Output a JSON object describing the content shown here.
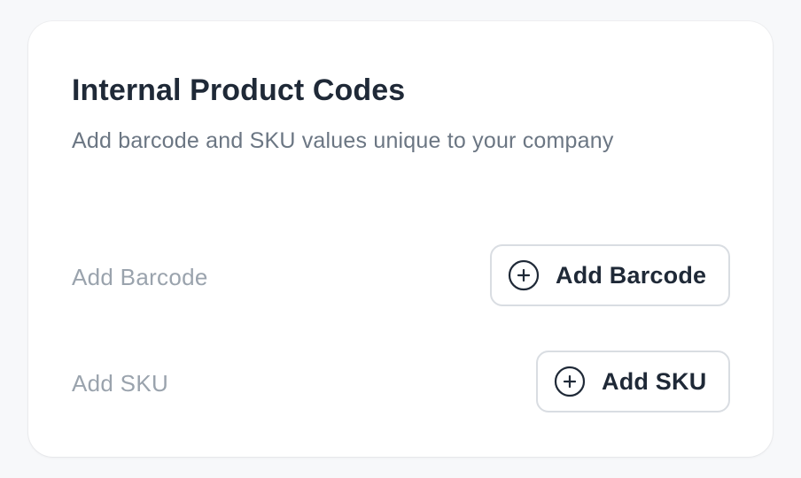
{
  "card": {
    "title": "Internal Product Codes",
    "subtitle": "Add barcode and SKU values unique to your company"
  },
  "rows": [
    {
      "label": "Add Barcode",
      "button_label": "Add Barcode",
      "button_icon": "plus-circle-icon"
    },
    {
      "label": "Add SKU",
      "button_label": "Add SKU",
      "button_icon": "plus-circle-icon"
    }
  ],
  "colors": {
    "background": "#f7f8fa",
    "card": "#ffffff",
    "title": "#1f2937",
    "subtitle": "#6b7683",
    "row_label": "#9aa3ad",
    "button_border": "#d9dde2"
  }
}
